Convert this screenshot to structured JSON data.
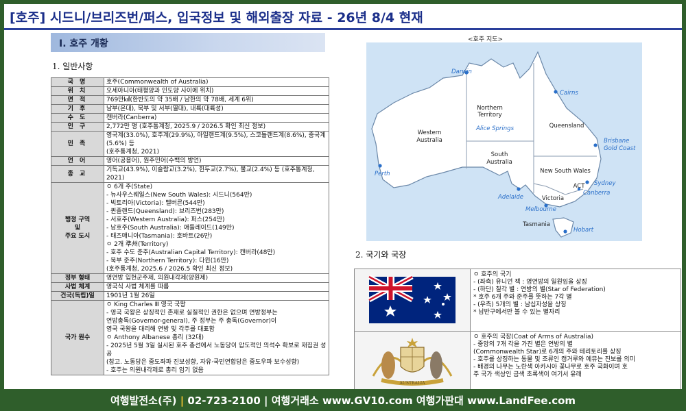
{
  "header": {
    "title": "[호주] 시드니/브리즈번/퍼스, 입국정보 및 해외출장 자료 - 26년 8/4 현재"
  },
  "section1": {
    "title": "Ⅰ. 호주 개황",
    "subtitle": "1. 일반사항"
  },
  "info_rows": [
    {
      "key": "국 명",
      "value": "호주(Commonwealth of Australia)"
    },
    {
      "key": "위 치",
      "value": "오세아니아(태평양과 인도양 사이에 위치)"
    },
    {
      "key": "면 적",
      "value": "769만㎢(한반도의 약 35배 / 남한의 약 78배, 세계 6위)"
    },
    {
      "key": "기 후",
      "value": "남부(온대), 북부 및 서부(열대), 내륙(대륙성)"
    },
    {
      "key": "수 도",
      "value": "캔버라(Canberra)"
    },
    {
      "key": "인 구",
      "value": "2,772만 명 (호주통계청, 2025.9 / 2026.5 확인 최신 정보)"
    },
    {
      "key": "민 족",
      "value": "영국계(33.0%), 호주계(29.9%), 아일랜드계(9.5%), 스코틀랜드계(8.6%), 중국계(5.6%) 등\n(호주통계청, 2021)"
    },
    {
      "key": "언 어",
      "value": "영어(공용어), 원주민어(수백의 방언)"
    },
    {
      "key": "종 교",
      "value": "기독교(43.9%), 이슬람교(3.2%), 힌두교(2.7%), 불교(2.4%) 등 (호주통계청, 2021)"
    },
    {
      "key": "행정 구역\n및\n주요 도시",
      "value": "ㅇ 6개 주(State)\n - 뉴사우스웨일스(New South Wales): 시드니(564만)\n - 빅토리아(Victoria): 멜버른(544만)\n - 퀸즐랜드(Queensland): 브리즈번(283만)\n - 서호주(Western Australia): 퍼스(254만)\n - 남호주(South Australia): 애들레이드(149만)\n - 태즈매니아(Tasmania): 호바트(26만)\nㅇ 2개 準州(Territory)\n - 호주 수도 준주(Australian Capital Territory): 캔버라(48만)\n - 북부 준주(Northern Territory): 다윈(16만)\n (호주통계청, 2025.6 / 2026.5 확인 최신 정보)"
    },
    {
      "key": "정부 형태",
      "value": "영연방 입헌군주제, 의원내각제(양원제)"
    },
    {
      "key": "사법 체계",
      "value": "영국식 사법 체계를 따름"
    },
    {
      "key": "건국(독립)일",
      "value": "1901년 1월 26일"
    },
    {
      "key": "국가 원수",
      "value": "ㅇ King Charles Ⅲ 영국 국왕\n - 영국 국왕은 상징적인 존재로 실질적인 권한은 없으며 연방정부는\n 연방총독(Governor-general), 주 정부는 주 총독(Governor)이\n 영국 국왕을 대리해 연방 및 각주를 대표함\nㅇ Anthony Albanese 총리 (32대)\n - 2025년 5월 3일 실시된 호주 총선에서 노동당이 압도적인 의석수 확보로 재집권 성공\n (참고. 노동당은 중도좌파 진보성향, 자유·국민연합당은 중도우파 보수성향)\n - 호주는 의원내각제로 총리 임기 없음"
    }
  ],
  "map": {
    "caption": "<호주 지도>",
    "regions": [
      "Western Australia",
      "Northern Territory",
      "South Australia",
      "Queensland",
      "New South Wales",
      "Victoria",
      "Tasmania",
      "ACT"
    ],
    "cities": [
      "Darwin",
      "Cairns",
      "Alice Springs",
      "Brisbane",
      "Gold Coast",
      "Perth",
      "Adelaide",
      "Sydney",
      "Canberra",
      "Melbourne",
      "Hobart"
    ],
    "colors": {
      "sea": "#cfe3f5",
      "land": "#ffffff",
      "city_label": "#2a6fc9"
    }
  },
  "section2": {
    "subtitle": "2. 국기와 국장"
  },
  "flag_section": {
    "flag_text": "ㅇ 호주의 국기\n - (좌측) 유니언 잭 : 영연방의 일원임을 상징\n - (하단) 칠각 별 : 연방의 별(Star of Federation)\n * 호주 6개 주와 준주를 뜻하는 7각 별\n - (우측) 5개의 별 : 남십자성을 상징\n * 남반구에서만 볼 수 있는 별자리",
    "coat_text": "ㅇ 호주의 국장(Coat of Arms of Australia)\n - 중앙의 7개 각을 가진 별은 연방의 별\n (Commonwealth Star)로 6개의 주와 테리토리를 상징\n - 호주를 상징하는 동물 및 조류인 캥거루와 에뮤는 진보를 의미\n - 배경의 나무는 노란색 아카시아 꽃나무로 호주 국화이며 호\n 주 국가 색상인 금색 초록색이 여기서 유래",
    "coat_ribbon": "AUSTRALIA",
    "colors": {
      "flag_blue": "#00247d",
      "flag_red": "#cf142b",
      "gold": "#c9a23a"
    }
  },
  "footer": {
    "part1": "여행발전소(주)",
    "phone": "02-723-2100",
    "part2": "여행거래소",
    "site1": "www.GV10.com",
    "part3": "여행가판대",
    "site2": "www.LandFee.com"
  }
}
